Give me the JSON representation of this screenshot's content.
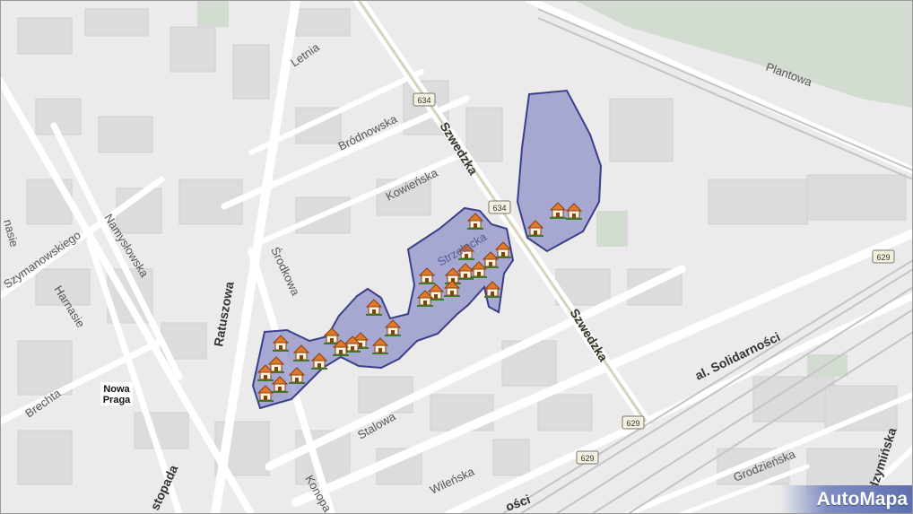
{
  "map": {
    "district_label": [
      "Nowa",
      "Praga"
    ],
    "streets": {
      "szwedzka_1": "Szwedzka",
      "szwedzka_2": "Szwedzka",
      "plantowa": "Plantowa",
      "brodnowska": "Bródnowska",
      "kowienska": "Kowieńska",
      "letnia": "Letnia",
      "namyslowska": "Namysłowska",
      "szymanowskiego": "Szymanowskiego",
      "harnasie": "Harnasie",
      "ratuszowa": "Ratuszowa",
      "srodkowa": "Środkowa",
      "strzelecka": "Strzelecka",
      "stalowa": "Stalowa",
      "brechta": "Brechta",
      "wilenska": "Wileńska",
      "konopacka": "Konopa",
      "listopada": "stopada",
      "solidarnosci": "al. Solidarności",
      "radzyminska": "Radzymińska",
      "grodzienska": "Grodzieńska",
      "fragment_left": "nasie",
      "fragment_bottom": "ości"
    },
    "road_numbers": [
      "634",
      "634",
      "629",
      "629",
      "629"
    ],
    "highlight_color": "#8f92c9",
    "highlight_border": "#3b3f8a",
    "marker_icon": "house-icon",
    "logo": "AutoMapa"
  }
}
